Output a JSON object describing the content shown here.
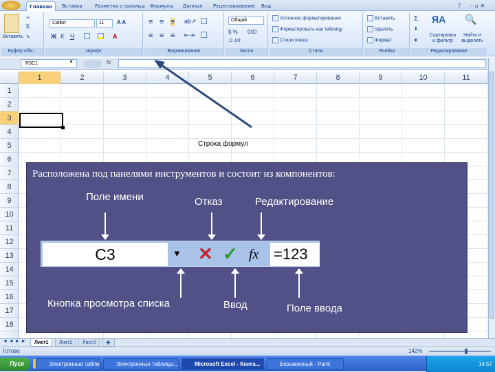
{
  "ribbon": {
    "tabs": [
      "Главная",
      "Вставка",
      "Разметка страницы",
      "Формулы",
      "Данные",
      "Рецензирование",
      "Вид"
    ],
    "active_tab": "Главная",
    "paste_label": "Вставить",
    "font_name": "Calibri",
    "font_size": "11",
    "number_format": "Общий",
    "styles": [
      "Условное форматирование",
      "Форматировать как таблицу",
      "Стили ячеек"
    ],
    "cells": [
      "Вставить",
      "Удалить",
      "Формат"
    ],
    "editing": [
      "Сортировка и фильтр",
      "Найти и выделить"
    ],
    "groups": [
      "Буфер обм...",
      "Шрифт",
      "Выравнивание",
      "Число",
      "Стили",
      "Ячейки",
      "Редактирование"
    ]
  },
  "formula_bar": {
    "name_box": "R3C1",
    "fx": "fx",
    "value": ""
  },
  "grid": {
    "columns": [
      "1",
      "2",
      "3",
      "4",
      "5",
      "6",
      "7",
      "8",
      "9",
      "10",
      "11"
    ],
    "rows": [
      "1",
      "2",
      "3",
      "4",
      "5",
      "6",
      "7",
      "8",
      "9",
      "10",
      "11",
      "12",
      "13",
      "14",
      "15",
      "16",
      "17",
      "18"
    ],
    "selected_row": "3"
  },
  "annotation": {
    "callout": "Строка формул",
    "title": "Расположена под панелями инструментов и состоит из компонентов:",
    "labels": {
      "name_field": "Поле имени",
      "cancel": "Отказ",
      "edit": "Редактирование",
      "dropdown": "Кнопка просмотра списка",
      "enter": "Ввод",
      "input": "Поле ввода"
    },
    "strip": {
      "name_value": "C3",
      "input_value": "=123",
      "fx": "fx"
    }
  },
  "sheets": [
    "Лист1",
    "Лист2",
    "Лист3"
  ],
  "active_sheet": "Лист1",
  "status": {
    "left": "Готово",
    "zoom": "142%"
  },
  "taskbar": {
    "start": "Пуск",
    "items": [
      "Электронные таблицы...",
      "Электронные таблицы...",
      "Microsoft Excel - Книга...",
      "Безымянный - Paint"
    ],
    "active_item": "Microsoft Excel - Книга...",
    "clock": "14:57"
  }
}
